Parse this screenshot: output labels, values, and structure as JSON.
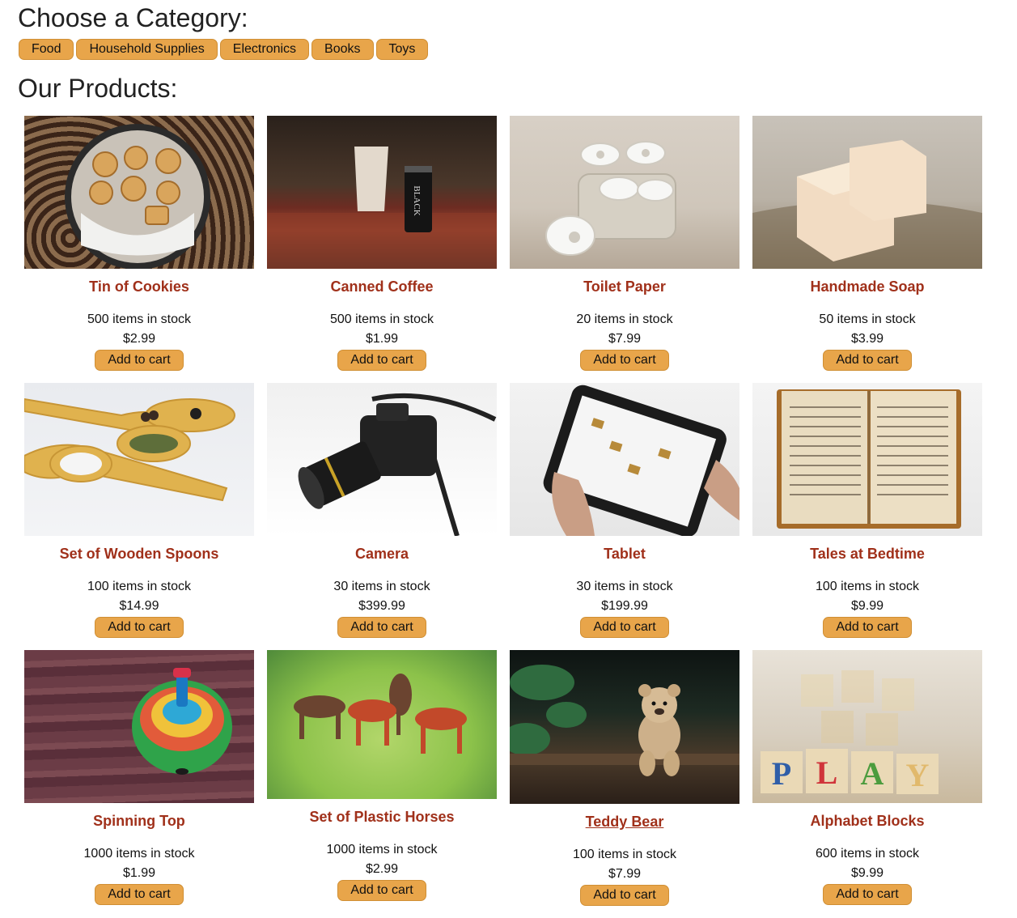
{
  "category_section": {
    "heading": "Choose a Category:",
    "categories": [
      "Food",
      "Household Supplies",
      "Electronics",
      "Books",
      "Toys"
    ]
  },
  "products_section": {
    "heading": "Our Products:",
    "add_to_cart_label": "Add to cart",
    "products": [
      {
        "name": "Tin of Cookies",
        "stock": "500 items in stock",
        "price": "$2.99"
      },
      {
        "name": "Canned Coffee",
        "stock": "500 items in stock",
        "price": "$1.99"
      },
      {
        "name": "Toilet Paper",
        "stock": "20 items in stock",
        "price": "$7.99"
      },
      {
        "name": "Handmade Soap",
        "stock": "50 items in stock",
        "price": "$3.99"
      },
      {
        "name": "Set of Wooden Spoons",
        "stock": "100 items in stock",
        "price": "$14.99"
      },
      {
        "name": "Camera",
        "stock": "30 items in stock",
        "price": "$399.99"
      },
      {
        "name": "Tablet",
        "stock": "30 items in stock",
        "price": "$199.99"
      },
      {
        "name": "Tales at Bedtime",
        "stock": "100 items in stock",
        "price": "$9.99"
      },
      {
        "name": "Spinning Top",
        "stock": "1000 items in stock",
        "price": "$1.99"
      },
      {
        "name": "Set of Plastic Horses",
        "stock": "1000 items in stock",
        "price": "$2.99"
      },
      {
        "name": "Teddy Bear",
        "stock": "100 items in stock",
        "price": "$7.99"
      },
      {
        "name": "Alphabet Blocks",
        "stock": "600 items in stock",
        "price": "$9.99"
      }
    ]
  },
  "colors": {
    "button_bg": "#e8a54a",
    "product_name": "#a0301a"
  },
  "image_subjects": [
    "cookies-tin-photo",
    "coffee-can-photo",
    "toilet-paper-photo",
    "soap-photo",
    "wooden-spoons-photo",
    "camera-photo",
    "tablet-photo",
    "book-photo",
    "spinning-top-photo",
    "plastic-horses-photo",
    "teddy-bear-photo",
    "alphabet-blocks-photo"
  ]
}
